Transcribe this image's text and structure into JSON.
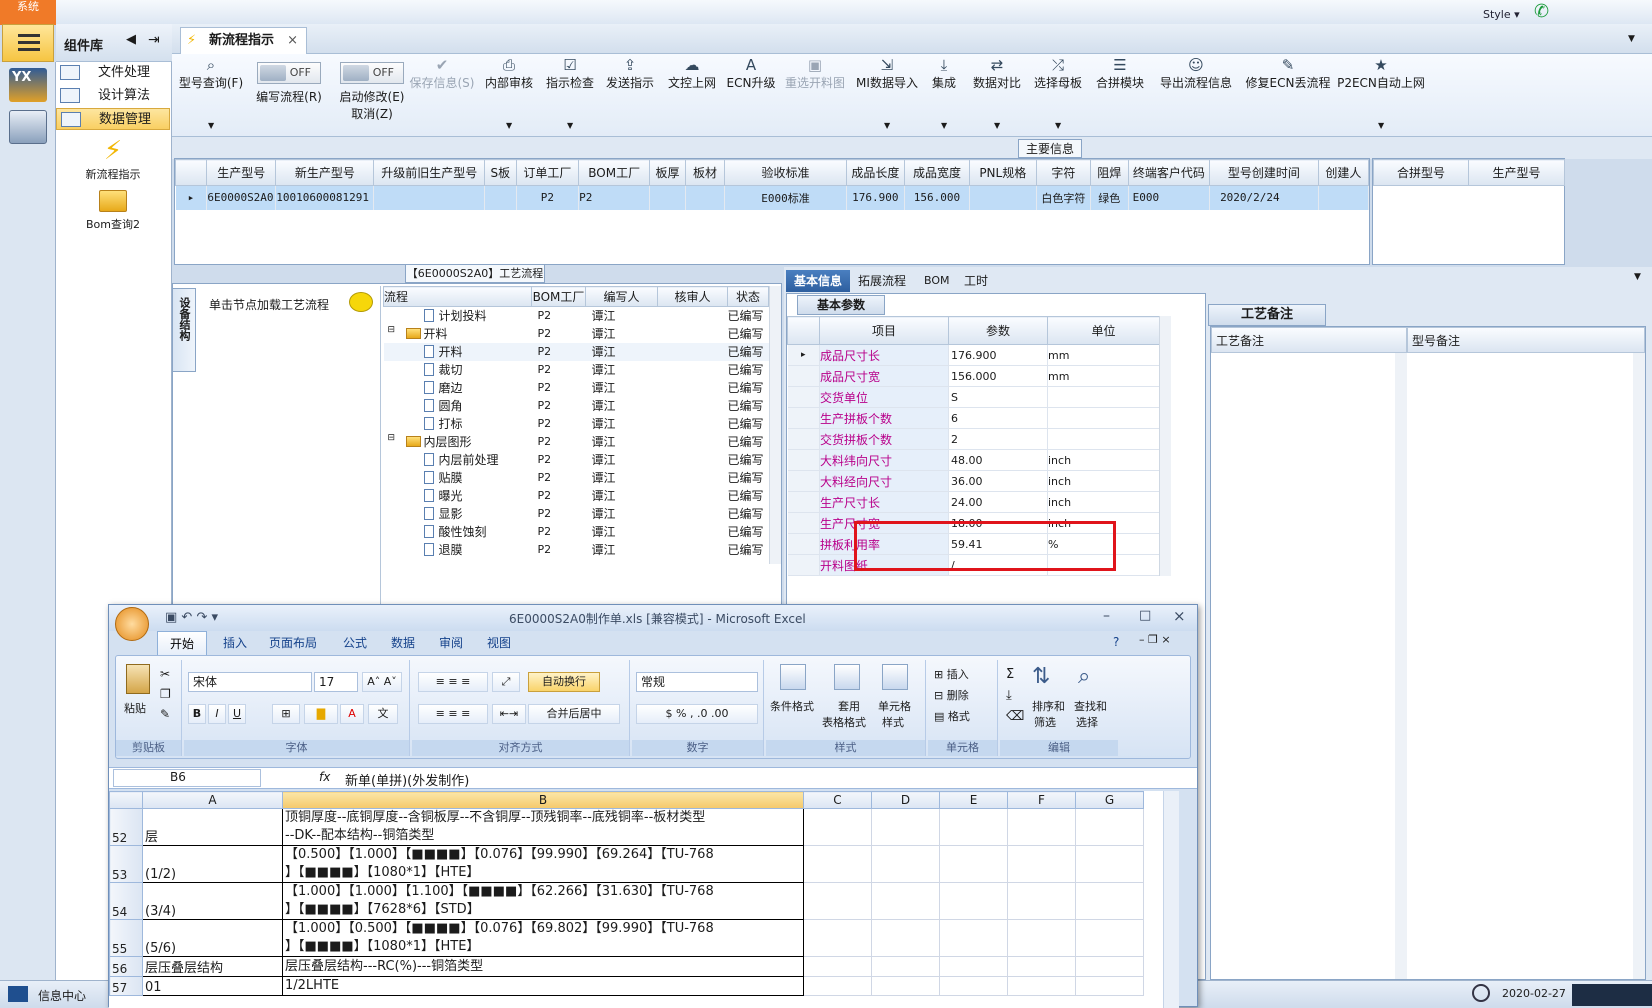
{
  "system": {
    "label": "系统",
    "style_label": "Style"
  },
  "library": {
    "title": "组件库",
    "items": [
      {
        "label": "文件处理",
        "selected": false
      },
      {
        "label": "设计算法",
        "selected": false
      },
      {
        "label": "数据管理",
        "selected": true
      }
    ],
    "launch": [
      {
        "label": "新流程指示",
        "icon": "lightning-icon"
      },
      {
        "label": "Bom查询2",
        "icon": "folder-icon"
      }
    ]
  },
  "doc_tab": {
    "label": "新流程指示"
  },
  "toolbar": {
    "items": [
      {
        "label": "型号查询(F)",
        "icon": "search-icon"
      },
      {
        "label": "编写流程(R)",
        "toggle": "OFF"
      },
      {
        "label": "启动修改(E)",
        "label2": "取消(Z)",
        "toggle": "OFF"
      },
      {
        "label": "保存信息(S)",
        "icon": "check-icon",
        "disabled": true
      },
      {
        "label": "内部审核",
        "icon": "print-icon"
      },
      {
        "label": "指示检查",
        "icon": "checkbox-icon"
      },
      {
        "label": "发送指示",
        "icon": "upload-icon"
      },
      {
        "label": "文控上网",
        "icon": "cloud-icon"
      },
      {
        "label": "ECN升级",
        "icon": "font-icon"
      },
      {
        "label": "重选开料图",
        "icon": "image-icon",
        "disabled": true
      },
      {
        "label": "MI数据导入",
        "icon": "import-icon"
      },
      {
        "label": "集成",
        "icon": "download-icon"
      },
      {
        "label": "数据对比",
        "icon": "compare-icon"
      },
      {
        "label": "选择母板",
        "icon": "shuffle-icon"
      },
      {
        "label": "合拼模块",
        "icon": "list-icon"
      },
      {
        "label": "导出流程信息",
        "icon": "smile-icon"
      },
      {
        "label": "修复ECN丢流程",
        "icon": "wrench-icon"
      },
      {
        "label": "P2ECN自动上网",
        "icon": "star-icon"
      }
    ]
  },
  "main_info": {
    "caption": "主要信息",
    "columns": [
      "生产型号",
      "新生产型号",
      "升级前旧生产型号",
      "S板",
      "订单工厂",
      "BOM工厂",
      "板厚",
      "板材",
      "验收标准",
      "成品长度",
      "成品宽度",
      "PNL规格",
      "字符",
      "阻焊",
      "终端客户代码",
      "型号创建时间",
      "创建人"
    ],
    "rows": [
      [
        "6E0000S2A0",
        "10010600081291",
        "",
        "",
        "P2",
        "P2",
        "",
        "",
        "E000标准",
        "176.900",
        "156.000",
        "",
        "白色字符",
        "绿色",
        "E000",
        "2020/2/24",
        ""
      ]
    ],
    "side_columns": [
      "合拼型号",
      "生产型号"
    ]
  },
  "process": {
    "caption": "【6E0000S2A0】工艺流程",
    "side_tab": "设备结构",
    "hint": "单击节点加载工艺流程",
    "columns": [
      "流程",
      "BOM工厂",
      "编写人",
      "核审人",
      "状态"
    ],
    "rows": [
      {
        "name": "计划投料",
        "indent": 2,
        "type": "doc",
        "bom": "P2",
        "writer": "谭江",
        "status": "已编写"
      },
      {
        "name": "开料",
        "indent": 1,
        "type": "folder",
        "bom": "P2",
        "writer": "谭江",
        "status": "已编写"
      },
      {
        "name": "开料",
        "indent": 2,
        "type": "doc",
        "bom": "P2",
        "writer": "谭江",
        "status": "已编写"
      },
      {
        "name": "裁切",
        "indent": 2,
        "type": "doc",
        "bom": "P2",
        "writer": "谭江",
        "status": "已编写"
      },
      {
        "name": "磨边",
        "indent": 2,
        "type": "doc",
        "bom": "P2",
        "writer": "谭江",
        "status": "已编写"
      },
      {
        "name": "圆角",
        "indent": 2,
        "type": "doc",
        "bom": "P2",
        "writer": "谭江",
        "status": "已编写"
      },
      {
        "name": "打标",
        "indent": 2,
        "type": "doc",
        "bom": "P2",
        "writer": "谭江",
        "status": "已编写"
      },
      {
        "name": "内层图形",
        "indent": 1,
        "type": "folder",
        "bom": "P2",
        "writer": "谭江",
        "status": "已编写"
      },
      {
        "name": "内层前处理",
        "indent": 2,
        "type": "doc",
        "bom": "P2",
        "writer": "谭江",
        "status": "已编写"
      },
      {
        "name": "贴膜",
        "indent": 2,
        "type": "doc",
        "bom": "P2",
        "writer": "谭江",
        "status": "已编写"
      },
      {
        "name": "曝光",
        "indent": 2,
        "type": "doc",
        "bom": "P2",
        "writer": "谭江",
        "status": "已编写"
      },
      {
        "name": "显影",
        "indent": 2,
        "type": "doc",
        "bom": "P2",
        "writer": "谭江",
        "status": "已编写"
      },
      {
        "name": "酸性蚀刻",
        "indent": 2,
        "type": "doc",
        "bom": "P2",
        "writer": "谭江",
        "status": "已编写"
      },
      {
        "name": "退膜",
        "indent": 2,
        "type": "doc",
        "bom": "P2",
        "writer": "谭江",
        "status": "已编写"
      }
    ]
  },
  "info_tabs": [
    "基本信息",
    "拓展流程",
    "BOM",
    "工时"
  ],
  "basic": {
    "section": "基本参数",
    "columns": [
      "项目",
      "参数",
      "单位"
    ],
    "rows": [
      {
        "item": "成品尺寸长",
        "value": "176.900",
        "unit": "mm"
      },
      {
        "item": "成品尺寸宽",
        "value": "156.000",
        "unit": "mm"
      },
      {
        "item": "交货单位",
        "value": "S",
        "unit": ""
      },
      {
        "item": "生产拼板个数",
        "value": "6",
        "unit": ""
      },
      {
        "item": "交货拼板个数",
        "value": "2",
        "unit": ""
      },
      {
        "item": "大料纬向尺寸",
        "value": "48.00",
        "unit": "inch"
      },
      {
        "item": "大料经向尺寸",
        "value": "36.00",
        "unit": "inch"
      },
      {
        "item": "生产尺寸长",
        "value": "24.00",
        "unit": "inch"
      },
      {
        "item": "生产尺寸宽",
        "value": "18.00",
        "unit": "inch"
      },
      {
        "item": "拼板利用率",
        "value": "59.41",
        "unit": "%"
      },
      {
        "item": "开料图纸",
        "value": "/",
        "unit": ""
      }
    ]
  },
  "remarks": {
    "section": "工艺备注",
    "col1": "工艺备注",
    "col2": "型号备注"
  },
  "excel": {
    "title": "6E0000S2A0制作单.xls [兼容模式] - Microsoft Excel",
    "tabs": [
      "开始",
      "插入",
      "页面布局",
      "公式",
      "数据",
      "审阅",
      "视图"
    ],
    "font": "宋体",
    "size": "17",
    "number_format": "常规",
    "groups": [
      "剪贴板",
      "字体",
      "对齐方式",
      "数字",
      "样式",
      "单元格",
      "编辑"
    ],
    "buttons": {
      "paste": "粘贴",
      "wrap": "自动换行",
      "merge": "合并后居中",
      "cond": "条件格式",
      "table1": "套用",
      "table2": "表格格式",
      "cell1": "单元格",
      "cell2": "样式",
      "insert": "插入",
      "delete": "删除",
      "format": "格式",
      "sort1": "排序和",
      "sort2": "筛选",
      "find1": "查找和",
      "find2": "选择"
    },
    "name_box": "B6",
    "formula": "新单(单拼)(外发制作)",
    "col_headers": [
      "A",
      "B",
      "C",
      "D",
      "E",
      "F",
      "G"
    ],
    "rows": [
      {
        "num": "52",
        "a": "层",
        "b1": "顶铜厚度--底铜厚度--含铜板厚--不含铜厚--顶残铜率--底残铜率--板材类型",
        "b2": "--DK--配本结构--铜箔类型"
      },
      {
        "num": "53",
        "a": "(1/2)",
        "b1": "【0.500】【1.000】【■■■■】【0.076】【99.990】【69.264】【TU-768",
        "b2": "】【■■■■】【1080*1】【HTE】"
      },
      {
        "num": "54",
        "a": "(3/4)",
        "b1": "【1.000】【1.000】【1.100】【■■■■】【62.266】【31.630】【TU-768",
        "b2": "】【■■■■】【7628*6】【STD】"
      },
      {
        "num": "55",
        "a": "(5/6)",
        "b1": "【1.000】【0.500】【■■■■】【0.076】【69.802】【99.990】【TU-768",
        "b2": "】【■■■■】【1080*1】【HTE】"
      },
      {
        "num": "56",
        "a": "层压叠层结构",
        "b1": "层压叠层结构---RC(%)---铜箔类型",
        "b2": ""
      },
      {
        "num": "57",
        "a": "01",
        "b1": "1/2LHTE",
        "b2": ""
      }
    ]
  },
  "status": {
    "info_center": "信息中心",
    "date": "2020-02-27"
  },
  "colors": {
    "accent": "#2e5f9f",
    "highlight": "#e0141b",
    "selected_row": "#bfdcf7"
  }
}
